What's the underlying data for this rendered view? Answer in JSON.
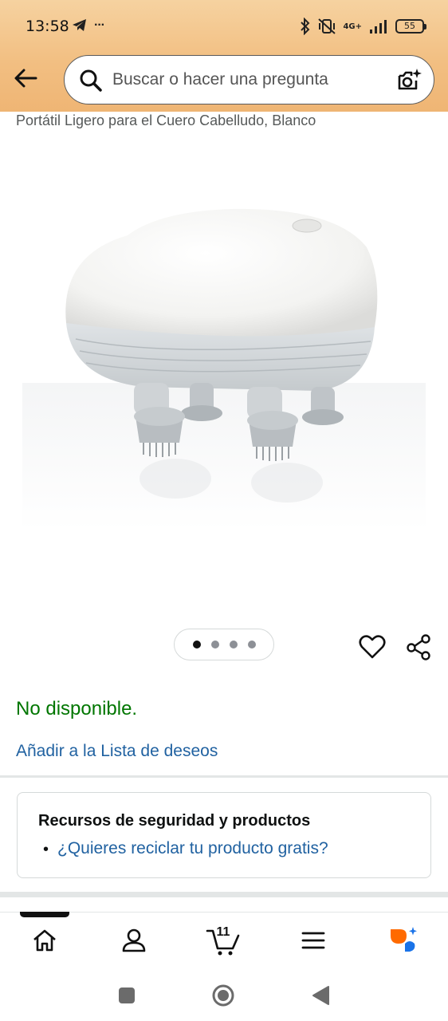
{
  "status_bar": {
    "time": "13:58",
    "more": "···",
    "network": "4G+",
    "battery": "55"
  },
  "search": {
    "placeholder": "Buscar o hacer una pregunta"
  },
  "product": {
    "title_tail": "Portátil Ligero para el Cuero Cabelludo, Blanco",
    "image_count": 4,
    "active_image": 1,
    "availability": "No disponible.",
    "wishlist_link": "Añadir a la Lista de deseos"
  },
  "resources": {
    "title": "Recursos de seguridad y productos",
    "bullet": "•",
    "link": "¿Quieres reciclar tu producto gratis?"
  },
  "bottom_nav": {
    "items": [
      "home-icon",
      "account-icon",
      "cart-icon",
      "menu-icon",
      "rufus-icon"
    ],
    "cart_count": "11",
    "active": "home"
  },
  "colors": {
    "header_top": "#f6d2a0",
    "header_bottom": "#efb574",
    "available_green": "#007600",
    "link_blue": "#2162a1",
    "rufus_orange": "#ff6a00",
    "rufus_blue": "#1a73e8"
  }
}
